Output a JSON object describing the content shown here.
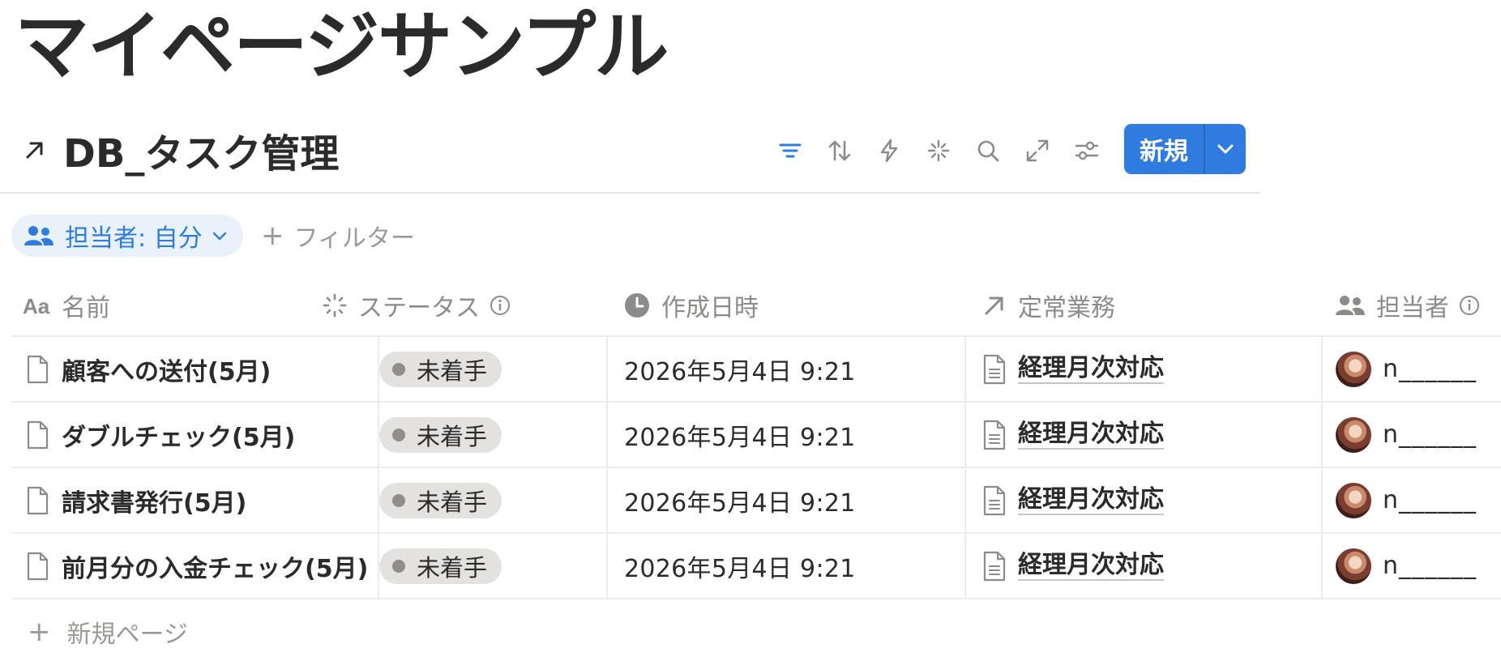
{
  "page": {
    "title": "マイページサンプル"
  },
  "database": {
    "title": "DB_タスク管理"
  },
  "toolbar": {
    "new_label": "新規"
  },
  "filters": {
    "chip_label": "担当者: 自分",
    "add_label": "フィルター"
  },
  "table": {
    "columns": [
      {
        "label": "名前"
      },
      {
        "label": "ステータス"
      },
      {
        "label": "作成日時"
      },
      {
        "label": "定常業務"
      },
      {
        "label": "担当者"
      }
    ],
    "rows": [
      {
        "name": "顧客への送付(5月)",
        "status": "未着手",
        "created": "2026年5月4日 9:21",
        "routine": "経理月次対応",
        "assignee": "n______"
      },
      {
        "name": "ダブルチェック(5月)",
        "status": "未着手",
        "created": "2026年5月4日 9:21",
        "routine": "経理月次対応",
        "assignee": "n______"
      },
      {
        "name": "請求書発行(5月)",
        "status": "未着手",
        "created": "2026年5月4日 9:21",
        "routine": "経理月次対応",
        "assignee": "n______"
      },
      {
        "name": "前月分の入金チェック(5月)",
        "status": "未着手",
        "created": "2026年5月4日 9:21",
        "routine": "経理月次対応",
        "assignee": "n______"
      }
    ],
    "new_page_label": "新規ページ"
  },
  "colors": {
    "accent": "#2f7be0",
    "chip_bg": "#e9f1fb",
    "status_pill": "#e3e2e0",
    "status_dot": "#8f8e8b"
  },
  "icons": [
    "link-arrow-icon",
    "filter-icon",
    "sort-icon",
    "automation-bolt-icon",
    "ai-sparkle-icon",
    "search-icon",
    "expand-icon",
    "settings-sliders-icon",
    "chevron-down-icon",
    "people-icon",
    "plus-icon",
    "text-aa-icon",
    "status-spinner-icon",
    "info-icon",
    "clock-icon",
    "relation-arrow-icon",
    "page-doc-icon",
    "avatar"
  ]
}
